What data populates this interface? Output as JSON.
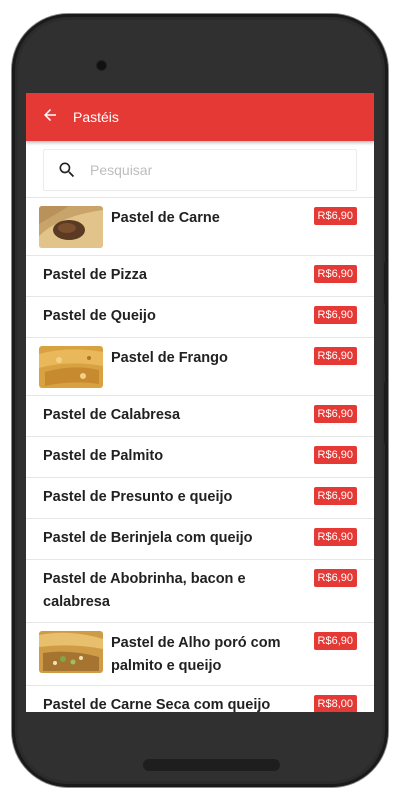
{
  "appbar": {
    "title": "Pastéis"
  },
  "search": {
    "placeholder": "Pesquisar"
  },
  "colors": {
    "accent": "#e53935"
  },
  "items": [
    {
      "name": "Pastel de Carne",
      "price": "R$6,90",
      "image": "pastel-carne-photo"
    },
    {
      "name": "Pastel de Pizza",
      "price": "R$6,90"
    },
    {
      "name": "Pastel de Queijo",
      "price": "R$6,90"
    },
    {
      "name": "Pastel de Frango",
      "price": "R$6,90",
      "image": "pastel-frango-photo"
    },
    {
      "name": "Pastel de Calabresa",
      "price": "R$6,90"
    },
    {
      "name": "Pastel de Palmito",
      "price": "R$6,90"
    },
    {
      "name": "Pastel de Presunto e queijo",
      "price": "R$6,90"
    },
    {
      "name": "Pastel de Berinjela com queijo",
      "price": "R$6,90"
    },
    {
      "name": "Pastel de Abobrinha, bacon e calabresa",
      "price": "R$6,90"
    },
    {
      "name": "Pastel de Alho poró com palmito e queijo",
      "price": "R$6,90",
      "image": "pastel-alho-poro-photo"
    },
    {
      "name": "Pastel de Carne Seca com queijo",
      "price": "R$8,00"
    }
  ]
}
